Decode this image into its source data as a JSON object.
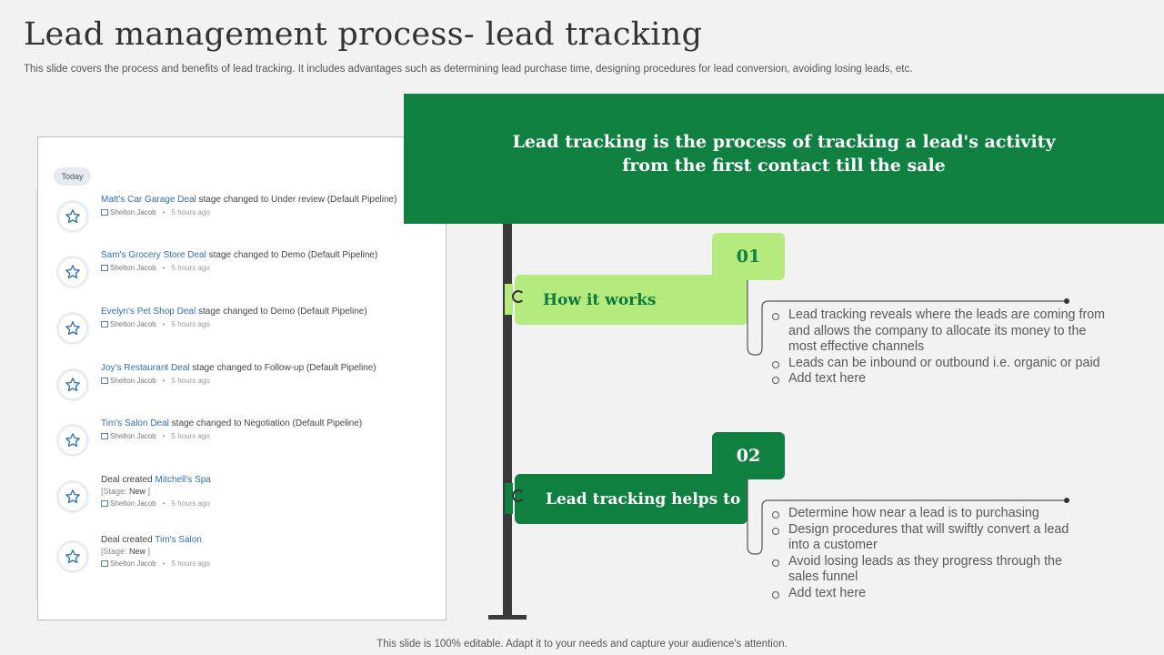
{
  "header": {
    "title": "Lead management process- lead tracking",
    "subtitle": "This slide covers the process and benefits of lead tracking. It includes advantages such as determining lead purchase time, designing procedures for lead conversion, avoiding losing leads, etc."
  },
  "feed": {
    "today_label": "Today",
    "items": [
      {
        "link": "Matt's Car Garage Deal",
        "text": " stage changed to Under review (Default Pipeline)",
        "user": "Shelton Jacob",
        "time": "5 hours ago"
      },
      {
        "link": "Sam's Grocery Store Deal",
        "text": " stage changed to Demo (Default Pipeline)",
        "user": "Shelton Jacob",
        "time": "5 hours ago"
      },
      {
        "link": "Evelyn's Pet Shop Deal",
        "text": " stage changed to Demo (Default Pipeline)",
        "user": "Shelton Jacob",
        "time": "5 hours ago"
      },
      {
        "link": "Joy's Restaurant Deal",
        "text": " stage changed to Follow-up (Default Pipeline)",
        "user": "Shelton Jacob",
        "time": "5 hours ago"
      },
      {
        "link": "Tim's Salon Deal",
        "text": " stage changed to Negotiation (Default Pipeline)",
        "user": "Shelton Jacob",
        "time": "5 hours ago"
      },
      {
        "prefix": "Deal created ",
        "link": "Mitchell's Spa",
        "stage_label": "[Stage: ",
        "stage_value": "New",
        "stage_close": " ]",
        "user": "Shelton Jacob",
        "time": "5 hours ago"
      },
      {
        "prefix": "Deal created ",
        "link": "Tim's Salon",
        "stage_label": "[Stage: ",
        "stage_value": "New",
        "stage_close": " ]",
        "user": "Shelton Jacob",
        "time": "5 hours ago"
      }
    ]
  },
  "definition": "Lead tracking is the process of tracking a lead's activity from the first contact till the sale",
  "sections": [
    {
      "number": "01",
      "label": "How it works",
      "bullets": [
        "Lead tracking reveals where the leads are coming from and allows the company to allocate its money to the most effective channels",
        "Leads can be inbound or outbound i.e. organic or paid",
        "Add text here"
      ]
    },
    {
      "number": "02",
      "label": "Lead tracking helps to",
      "bullets": [
        "Determine how near a lead is to purchasing",
        "Design procedures that will swiftly convert a lead into a customer",
        "Avoid losing leads as they progress through the sales funnel",
        "Add text here"
      ]
    }
  ],
  "footer": "This slide is 100% editable. Adapt it to your needs and capture your audience's attention.",
  "colors": {
    "dark_green": "#0f8040",
    "light_green": "#b5ea7e",
    "background": "#f2f2f2"
  },
  "icons": {
    "feed_item": "star-icon",
    "user": "user-icon"
  }
}
